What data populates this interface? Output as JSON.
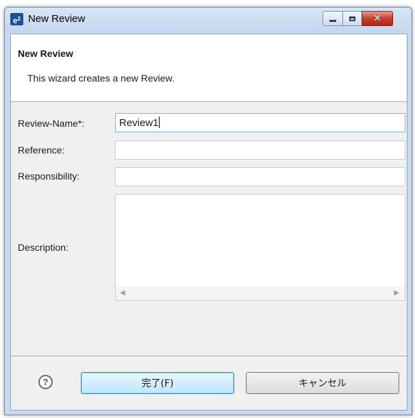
{
  "window": {
    "icon_text": "e",
    "icon_sup": "2",
    "title": "New Review",
    "minimize_icon": "minimize-icon",
    "maximize_icon": "maximize-icon",
    "close_icon": "close-icon",
    "close_glyph": "✕"
  },
  "header": {
    "title": "New Review",
    "message": "This wizard creates a new Review."
  },
  "form": {
    "review_name_label": "Review-Name*:",
    "review_name_value": "Review1",
    "reference_label": "Reference:",
    "reference_value": "",
    "responsibility_label": "Responsibility:",
    "responsibility_value": "",
    "description_label": "Description:",
    "description_value": "",
    "scroll_left": "◀",
    "scroll_right": "▶"
  },
  "footer": {
    "help_icon": "help-icon",
    "help_glyph": "?",
    "finish_label": "完了(F)",
    "cancel_label": "キャンセル"
  }
}
